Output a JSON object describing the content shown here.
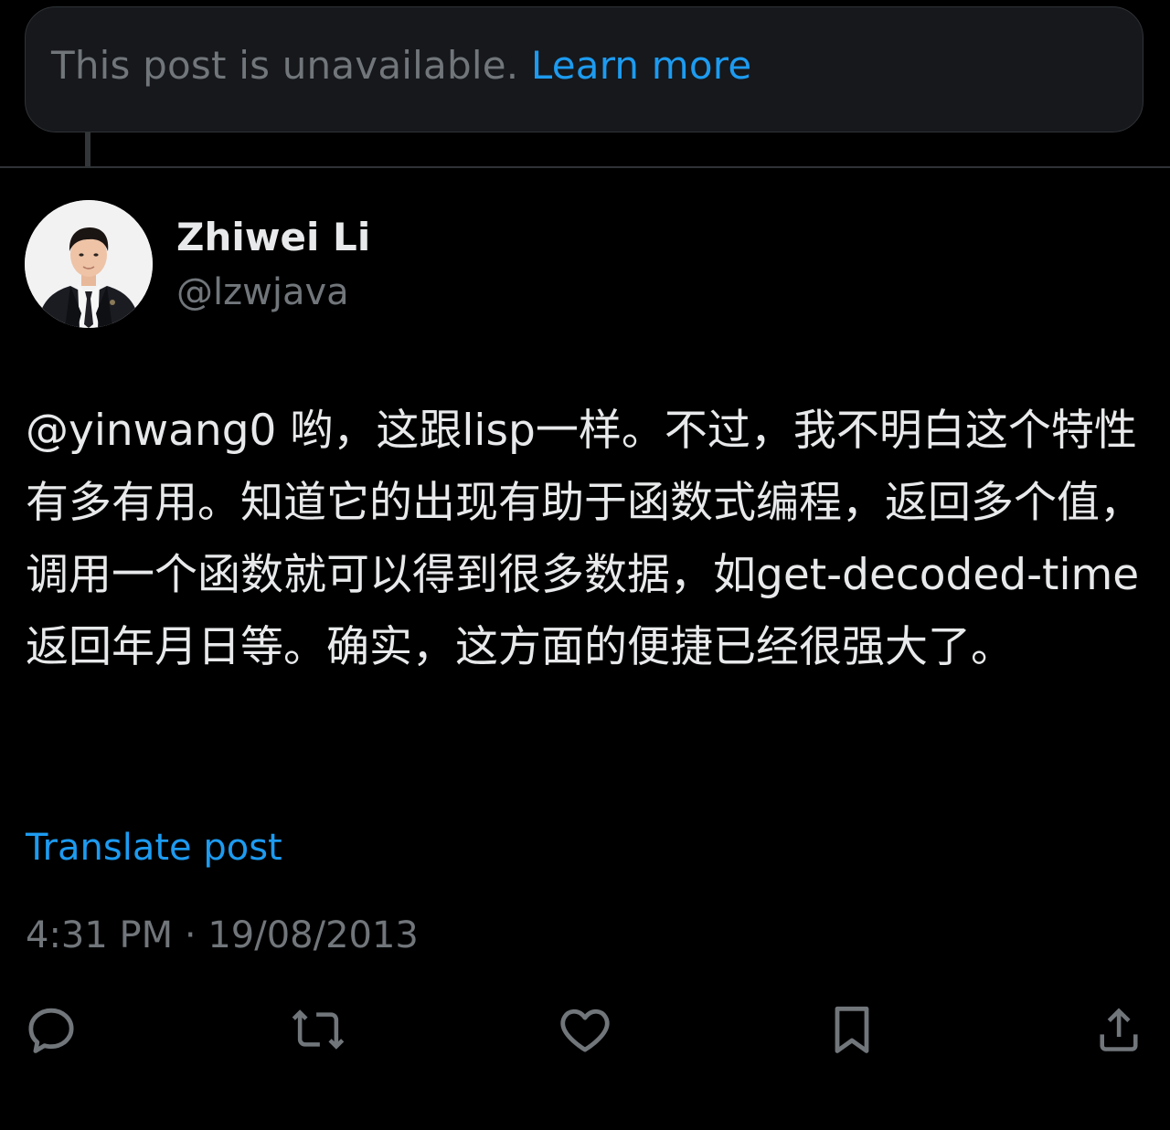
{
  "unavailable_notice": {
    "text": "This post is unavailable.",
    "link_label": "Learn more"
  },
  "author": {
    "display_name": "Zhiwei Li",
    "handle": "@lzwjava"
  },
  "post": {
    "mention": "@yinwang0",
    "text": " 哟，这跟lisp一样。不过，我不明白这个特性有多有用。知道它的出现有助于函数式编程，返回多个值，调用一个函数就可以得到很多数据，如get-decoded-time返回年月日等。确实，这方面的便捷已经很强大了。",
    "translate_label": "Translate post",
    "time": "4:31 PM",
    "separator": "·",
    "date": "19/08/2013"
  },
  "actions": [
    {
      "name": "reply",
      "icon": "reply-icon"
    },
    {
      "name": "repost",
      "icon": "repost-icon"
    },
    {
      "name": "like",
      "icon": "like-icon"
    },
    {
      "name": "bookmark",
      "icon": "bookmark-icon"
    },
    {
      "name": "share",
      "icon": "share-icon"
    }
  ],
  "colors": {
    "background": "#000000",
    "card": "#16181c",
    "primary_text": "#e7e9ea",
    "secondary_text": "#71767b",
    "link": "#1d9bf0",
    "border": "#2f3336"
  }
}
